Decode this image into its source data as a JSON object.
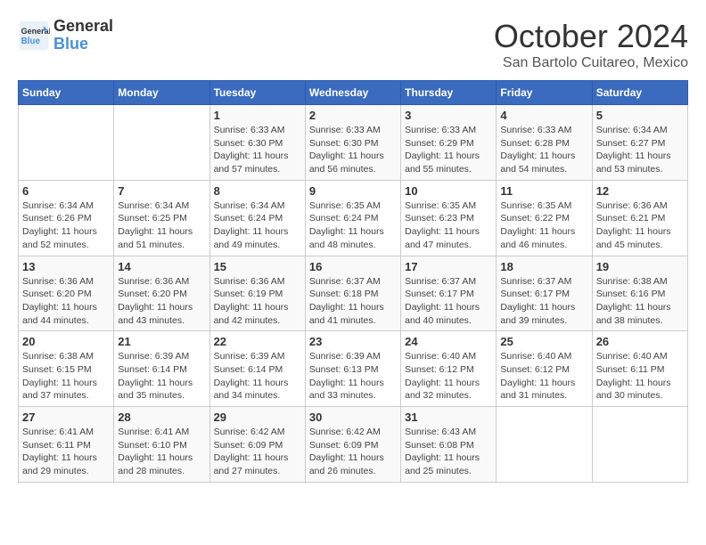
{
  "header": {
    "logo_line1": "General",
    "logo_line2": "Blue",
    "month": "October 2024",
    "location": "San Bartolo Cuitareo, Mexico"
  },
  "weekdays": [
    "Sunday",
    "Monday",
    "Tuesday",
    "Wednesday",
    "Thursday",
    "Friday",
    "Saturday"
  ],
  "weeks": [
    [
      {
        "day": "",
        "info": ""
      },
      {
        "day": "",
        "info": ""
      },
      {
        "day": "1",
        "info": "Sunrise: 6:33 AM\nSunset: 6:30 PM\nDaylight: 11 hours\nand 57 minutes."
      },
      {
        "day": "2",
        "info": "Sunrise: 6:33 AM\nSunset: 6:30 PM\nDaylight: 11 hours\nand 56 minutes."
      },
      {
        "day": "3",
        "info": "Sunrise: 6:33 AM\nSunset: 6:29 PM\nDaylight: 11 hours\nand 55 minutes."
      },
      {
        "day": "4",
        "info": "Sunrise: 6:33 AM\nSunset: 6:28 PM\nDaylight: 11 hours\nand 54 minutes."
      },
      {
        "day": "5",
        "info": "Sunrise: 6:34 AM\nSunset: 6:27 PM\nDaylight: 11 hours\nand 53 minutes."
      }
    ],
    [
      {
        "day": "6",
        "info": "Sunrise: 6:34 AM\nSunset: 6:26 PM\nDaylight: 11 hours\nand 52 minutes."
      },
      {
        "day": "7",
        "info": "Sunrise: 6:34 AM\nSunset: 6:25 PM\nDaylight: 11 hours\nand 51 minutes."
      },
      {
        "day": "8",
        "info": "Sunrise: 6:34 AM\nSunset: 6:24 PM\nDaylight: 11 hours\nand 49 minutes."
      },
      {
        "day": "9",
        "info": "Sunrise: 6:35 AM\nSunset: 6:24 PM\nDaylight: 11 hours\nand 48 minutes."
      },
      {
        "day": "10",
        "info": "Sunrise: 6:35 AM\nSunset: 6:23 PM\nDaylight: 11 hours\nand 47 minutes."
      },
      {
        "day": "11",
        "info": "Sunrise: 6:35 AM\nSunset: 6:22 PM\nDaylight: 11 hours\nand 46 minutes."
      },
      {
        "day": "12",
        "info": "Sunrise: 6:36 AM\nSunset: 6:21 PM\nDaylight: 11 hours\nand 45 minutes."
      }
    ],
    [
      {
        "day": "13",
        "info": "Sunrise: 6:36 AM\nSunset: 6:20 PM\nDaylight: 11 hours\nand 44 minutes."
      },
      {
        "day": "14",
        "info": "Sunrise: 6:36 AM\nSunset: 6:20 PM\nDaylight: 11 hours\nand 43 minutes."
      },
      {
        "day": "15",
        "info": "Sunrise: 6:36 AM\nSunset: 6:19 PM\nDaylight: 11 hours\nand 42 minutes."
      },
      {
        "day": "16",
        "info": "Sunrise: 6:37 AM\nSunset: 6:18 PM\nDaylight: 11 hours\nand 41 minutes."
      },
      {
        "day": "17",
        "info": "Sunrise: 6:37 AM\nSunset: 6:17 PM\nDaylight: 11 hours\nand 40 minutes."
      },
      {
        "day": "18",
        "info": "Sunrise: 6:37 AM\nSunset: 6:17 PM\nDaylight: 11 hours\nand 39 minutes."
      },
      {
        "day": "19",
        "info": "Sunrise: 6:38 AM\nSunset: 6:16 PM\nDaylight: 11 hours\nand 38 minutes."
      }
    ],
    [
      {
        "day": "20",
        "info": "Sunrise: 6:38 AM\nSunset: 6:15 PM\nDaylight: 11 hours\nand 37 minutes."
      },
      {
        "day": "21",
        "info": "Sunrise: 6:39 AM\nSunset: 6:14 PM\nDaylight: 11 hours\nand 35 minutes."
      },
      {
        "day": "22",
        "info": "Sunrise: 6:39 AM\nSunset: 6:14 PM\nDaylight: 11 hours\nand 34 minutes."
      },
      {
        "day": "23",
        "info": "Sunrise: 6:39 AM\nSunset: 6:13 PM\nDaylight: 11 hours\nand 33 minutes."
      },
      {
        "day": "24",
        "info": "Sunrise: 6:40 AM\nSunset: 6:12 PM\nDaylight: 11 hours\nand 32 minutes."
      },
      {
        "day": "25",
        "info": "Sunrise: 6:40 AM\nSunset: 6:12 PM\nDaylight: 11 hours\nand 31 minutes."
      },
      {
        "day": "26",
        "info": "Sunrise: 6:40 AM\nSunset: 6:11 PM\nDaylight: 11 hours\nand 30 minutes."
      }
    ],
    [
      {
        "day": "27",
        "info": "Sunrise: 6:41 AM\nSunset: 6:11 PM\nDaylight: 11 hours\nand 29 minutes."
      },
      {
        "day": "28",
        "info": "Sunrise: 6:41 AM\nSunset: 6:10 PM\nDaylight: 11 hours\nand 28 minutes."
      },
      {
        "day": "29",
        "info": "Sunrise: 6:42 AM\nSunset: 6:09 PM\nDaylight: 11 hours\nand 27 minutes."
      },
      {
        "day": "30",
        "info": "Sunrise: 6:42 AM\nSunset: 6:09 PM\nDaylight: 11 hours\nand 26 minutes."
      },
      {
        "day": "31",
        "info": "Sunrise: 6:43 AM\nSunset: 6:08 PM\nDaylight: 11 hours\nand 25 minutes."
      },
      {
        "day": "",
        "info": ""
      },
      {
        "day": "",
        "info": ""
      }
    ]
  ]
}
